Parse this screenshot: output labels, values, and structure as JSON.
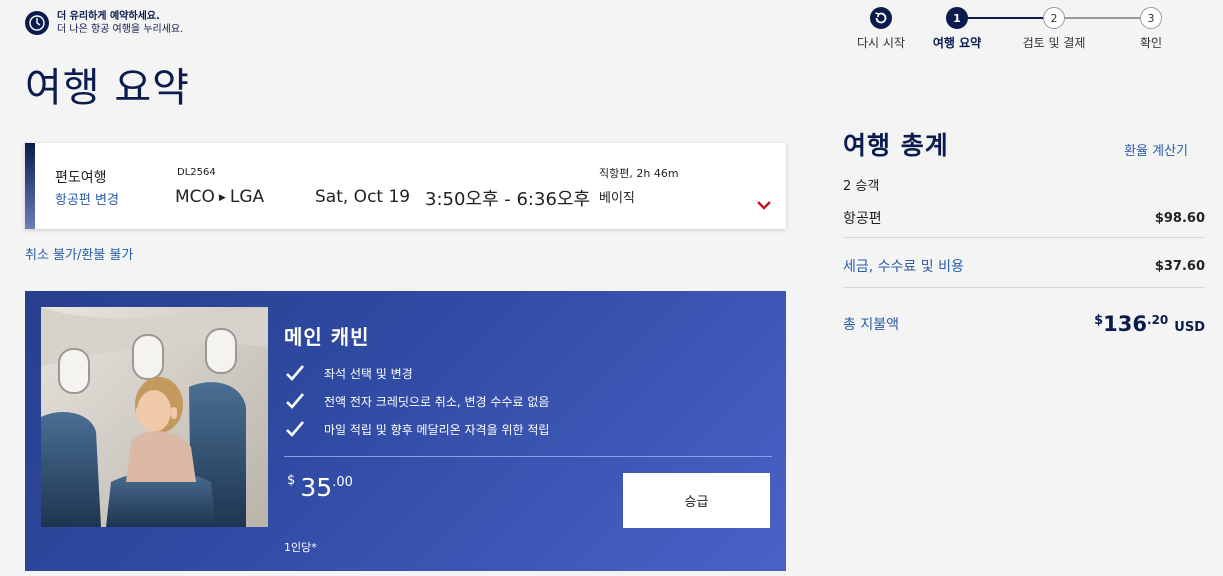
{
  "promo": {
    "line1": "더 유리하게 예약하세요.",
    "line2": "더 나은 항공 여행을 누리세요."
  },
  "page_title": "여행 요약",
  "stepper": {
    "restart_label": "다시 시작",
    "steps": [
      {
        "number": "1",
        "label": "여행 요약",
        "active": true
      },
      {
        "number": "2",
        "label": "검토 및 결제",
        "active": false
      },
      {
        "number": "3",
        "label": "확인",
        "active": false
      }
    ]
  },
  "flight": {
    "trip_type": "편도여행",
    "change_flight": "항공편 변경",
    "flight_number": "DL2564",
    "origin": "MCO",
    "destination": "LGA",
    "date": "Sat, Oct 19",
    "time": "3:50오후 - 6:36오후",
    "nonstop": "직항편, 2h 46m",
    "fare_class": "베이직"
  },
  "refund_note": "취소 불가/환불 불가",
  "upsell": {
    "cabin_title": "메인 캐빈",
    "features": [
      "좌석 선택 및 변경",
      "전액 전자 크레딧으로 취소, 변경 수수료 없음",
      "마일 적립 및 향후 메달리온 자격을 위한 적립"
    ],
    "price_currency": "$",
    "price_whole": "35",
    "price_cents": ".00",
    "per_person": "1인당*",
    "upgrade_button": "승급"
  },
  "summary": {
    "title": "여행 총계",
    "fx_link": "환율 계산기",
    "passengers": "2 승객",
    "flight_label": "항공편",
    "flight_value": "$98.60",
    "taxes_label": "세금, 수수료 및 비용",
    "taxes_value": "$37.60",
    "total_label": "총 지불액",
    "total_currency": "$",
    "total_whole": "136",
    "total_cents": ".20",
    "total_ccy": "USD"
  },
  "colors": {
    "navy": "#0b1b4d",
    "link_blue": "#2a5ea8",
    "upsell_blue": "#2f4aa2",
    "chevron_red": "#c8102e"
  }
}
